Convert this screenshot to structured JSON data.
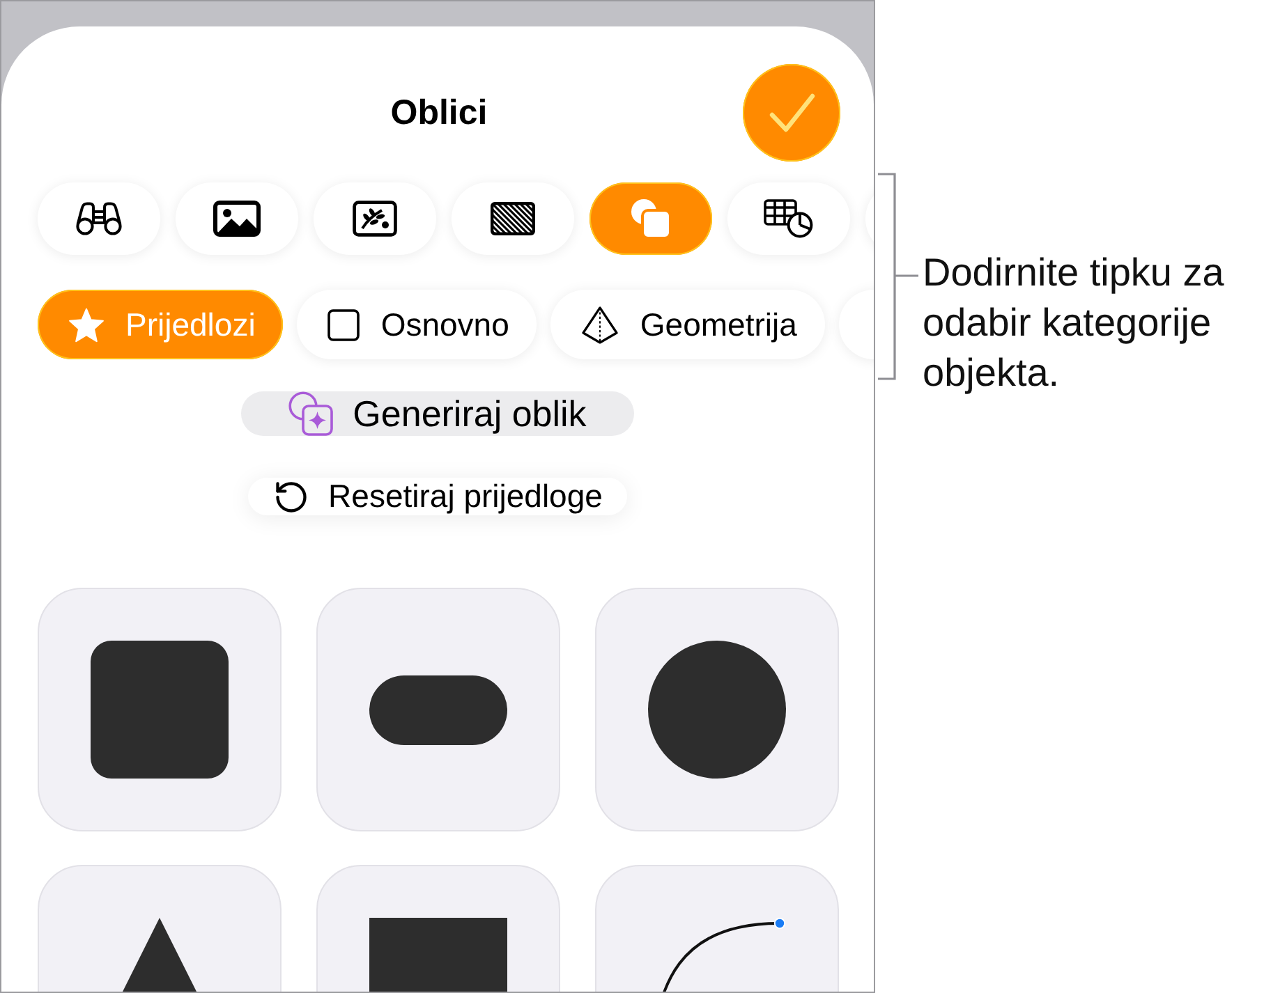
{
  "sheet": {
    "title": "Oblici"
  },
  "source_tabs": [
    {
      "selected": false
    },
    {
      "selected": false
    },
    {
      "selected": false
    },
    {
      "selected": false
    },
    {
      "selected": true
    },
    {
      "selected": false
    },
    {
      "selected": false
    }
  ],
  "categories": [
    {
      "label": "Prijedlozi",
      "selected": true
    },
    {
      "label": "Osnovno",
      "selected": false
    },
    {
      "label": "Geometrija",
      "selected": false
    },
    {
      "selected": false
    }
  ],
  "generate_button": {
    "label": "Generiraj oblik"
  },
  "reset_button": {
    "label": "Resetiraj prijedloge"
  },
  "shapes": [
    {
      "kind": "rounded-square"
    },
    {
      "kind": "capsule"
    },
    {
      "kind": "circle"
    },
    {
      "kind": "triangle"
    },
    {
      "kind": "square"
    },
    {
      "kind": "curve"
    }
  ],
  "callout": {
    "text": "Dodirnite tipku za odabir kategorije objekta."
  }
}
